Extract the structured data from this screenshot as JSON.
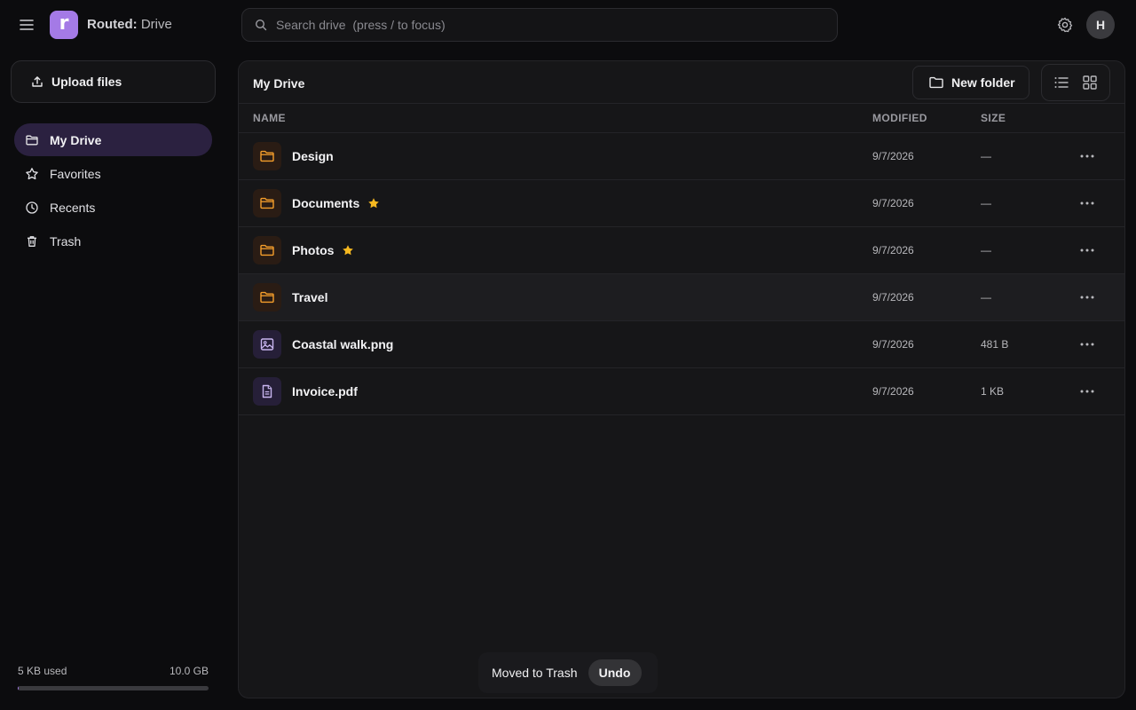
{
  "app": {
    "logo_letter": "r",
    "brand_bold": "Routed:",
    "brand_rest": " Drive",
    "accent": "#a47ae6"
  },
  "search": {
    "placeholder": "Search drive  (press / to focus)",
    "value": ""
  },
  "user": {
    "initial": "H"
  },
  "sidebar": {
    "upload_label": "Upload files",
    "items": [
      {
        "label": "My Drive",
        "icon": "folder-icon",
        "active": true
      },
      {
        "label": "Favorites",
        "icon": "star-icon",
        "active": false
      },
      {
        "label": "Recents",
        "icon": "clock-icon",
        "active": false
      },
      {
        "label": "Trash",
        "icon": "trash-icon",
        "active": false
      }
    ],
    "storage": {
      "used": "5 KB used",
      "total": "10.0 GB",
      "fill_fraction": 0.0005
    }
  },
  "main": {
    "title": "My Drive",
    "new_folder_label": "New folder",
    "columns": {
      "name": "NAME",
      "modified": "MODIFIED",
      "size": "SIZE"
    },
    "files": [
      {
        "name": "Design",
        "type": "folder",
        "starred": false,
        "modified": "9/7/2026",
        "size": "—"
      },
      {
        "name": "Documents",
        "type": "folder",
        "starred": true,
        "modified": "9/7/2026",
        "size": "—"
      },
      {
        "name": "Photos",
        "type": "folder",
        "starred": true,
        "modified": "9/7/2026",
        "size": "—"
      },
      {
        "name": "Travel",
        "type": "folder",
        "starred": false,
        "modified": "9/7/2026",
        "size": "—",
        "hovered": true
      },
      {
        "name": "Coastal walk.png",
        "type": "image",
        "starred": false,
        "modified": "9/7/2026",
        "size": "481 B"
      },
      {
        "name": "Invoice.pdf",
        "type": "document",
        "starred": false,
        "modified": "9/7/2026",
        "size": "1 KB"
      }
    ]
  },
  "toast": {
    "message": "Moved to Trash",
    "action": "Undo"
  },
  "colors": {
    "folder": "#f59e2b",
    "file_icon": "#c9b6f0",
    "star": "#f5b820",
    "active_nav_bg": "#2b2140"
  }
}
